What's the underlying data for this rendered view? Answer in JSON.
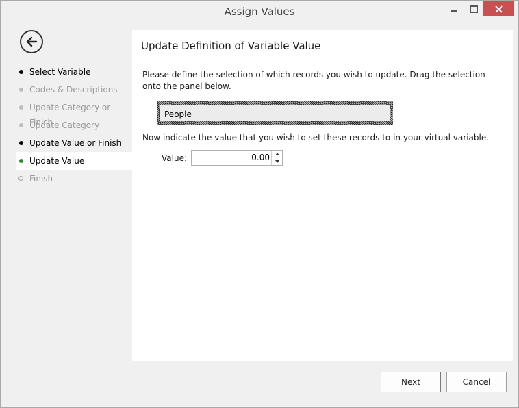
{
  "window": {
    "title": "Assign Values"
  },
  "sidebar": {
    "steps": [
      {
        "label": "Select Variable",
        "state": "completed"
      },
      {
        "label": "Codes & Descriptions",
        "state": "disabled"
      },
      {
        "label": "Update Category or Finish",
        "state": "disabled"
      },
      {
        "label": "Update Category",
        "state": "disabled"
      },
      {
        "label": "Update Value or Finish",
        "state": "completed"
      },
      {
        "label": "Update Value",
        "state": "active"
      },
      {
        "label": "Finish",
        "state": "disabled"
      }
    ]
  },
  "main": {
    "heading": "Update Definition of Variable Value",
    "instruction_selection": "Please define the selection of which records you wish to update. Drag the selection onto the panel below.",
    "selection_panel_label": "People",
    "instruction_value": "Now indicate the value that you wish to set these records to in your virtual variable.",
    "value_label": "Value:",
    "value": "_______0.00"
  },
  "footer": {
    "next_label": "Next",
    "cancel_label": "Cancel"
  },
  "colors": {
    "close_button": "#c75050",
    "active_step_dot": "#2c8a2c",
    "disabled_text": "#9a9a9a"
  },
  "icons": {
    "back": "back-arrow-icon",
    "close": "close-icon",
    "minimize": "minimize-icon",
    "maximize": "maximize-icon"
  }
}
